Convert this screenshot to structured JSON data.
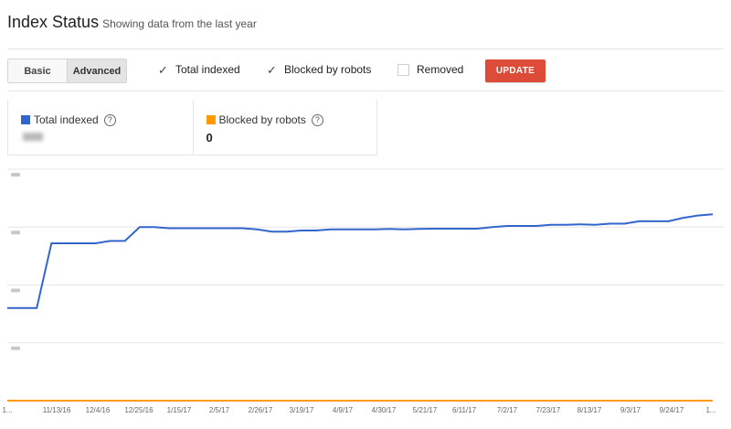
{
  "header": {
    "title": "Index Status",
    "subtitle": "Showing data from the last year"
  },
  "view_toggle": {
    "basic_label": "Basic",
    "advanced_label": "Advanced",
    "selected": "Advanced"
  },
  "filters": [
    {
      "label": "Total indexed",
      "checked": true
    },
    {
      "label": "Blocked by robots",
      "checked": true
    },
    {
      "label": "Removed",
      "checked": false
    }
  ],
  "update_label": "UPDATE",
  "cards": [
    {
      "label": "Total indexed",
      "color": "#3366cc",
      "value": "",
      "value_redacted": true
    },
    {
      "label": "Blocked by robots",
      "color": "#ff9900",
      "value": "0"
    }
  ],
  "help_glyph": "?",
  "chart_data": {
    "type": "line",
    "grid": true,
    "y_labels_redacted": true,
    "ylim": [
      0,
      100
    ],
    "categories": [
      "1...",
      "11/13/16",
      "12/4/16",
      "12/25/16",
      "1/15/17",
      "2/5/17",
      "2/26/17",
      "3/19/17",
      "4/9/17",
      "4/30/17",
      "5/21/17",
      "6/11/17",
      "7/2/17",
      "7/23/17",
      "8/13/17",
      "9/3/17",
      "9/24/17",
      "1..."
    ],
    "series": [
      {
        "name": "Total indexed",
        "color": "#3366cc",
        "values": [
          40,
          40,
          40,
          68,
          68,
          68,
          68,
          69,
          69,
          75,
          75,
          74.5,
          74.5,
          74.5,
          74.5,
          74.5,
          74.5,
          74,
          73,
          73,
          73.5,
          73.5,
          74,
          74,
          74,
          74,
          74.2,
          74,
          74.2,
          74.3,
          74.3,
          74.3,
          74.3,
          75,
          75.5,
          75.5,
          75.5,
          76,
          76,
          76.2,
          76,
          76.5,
          76.5,
          77.5,
          77.5,
          77.5,
          79,
          80,
          80.5
        ]
      },
      {
        "name": "Blocked by robots",
        "color": "#ff9900",
        "values": [
          0,
          0,
          0,
          0,
          0,
          0,
          0,
          0,
          0,
          0,
          0,
          0,
          0,
          0,
          0,
          0,
          0,
          0,
          0,
          0,
          0,
          0,
          0,
          0,
          0,
          0,
          0,
          0,
          0,
          0,
          0,
          0,
          0,
          0,
          0,
          0,
          0,
          0,
          0,
          0,
          0,
          0,
          0,
          0,
          0,
          0,
          0,
          0,
          0
        ]
      }
    ]
  }
}
